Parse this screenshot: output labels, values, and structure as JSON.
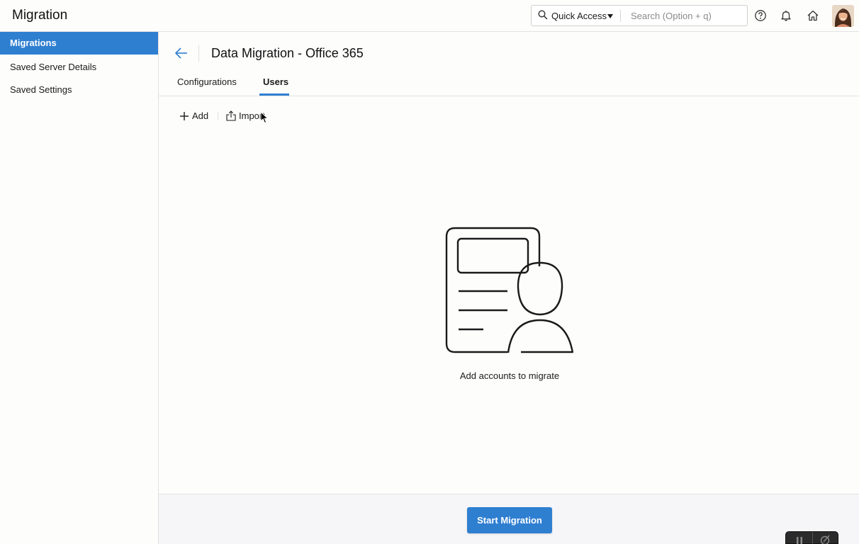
{
  "app": {
    "title": "Migration"
  },
  "topbar": {
    "quick_access_label": "Quick Access",
    "search_placeholder": "Search (Option + q)",
    "icons": [
      "search-icon",
      "help-icon",
      "bell-icon",
      "home-icon"
    ]
  },
  "sidebar": {
    "items": [
      {
        "label": "Migrations",
        "active": true
      },
      {
        "label": "Saved Server Details",
        "active": false
      },
      {
        "label": "Saved Settings",
        "active": false
      }
    ]
  },
  "page": {
    "title": "Data Migration - Office 365",
    "tabs": [
      {
        "label": "Configurations",
        "active": false
      },
      {
        "label": "Users",
        "active": true
      }
    ]
  },
  "toolbar": {
    "add_label": "Add",
    "import_label": "Import"
  },
  "empty_state": {
    "message": "Add accounts to migrate",
    "icon": "user-document-icon"
  },
  "footer": {
    "start_label": "Start Migration"
  },
  "colors": {
    "accent": "#2f7fd1",
    "sidebar_active_bg": "#2f7fd1",
    "footer_bg": "#f6f6f8"
  }
}
